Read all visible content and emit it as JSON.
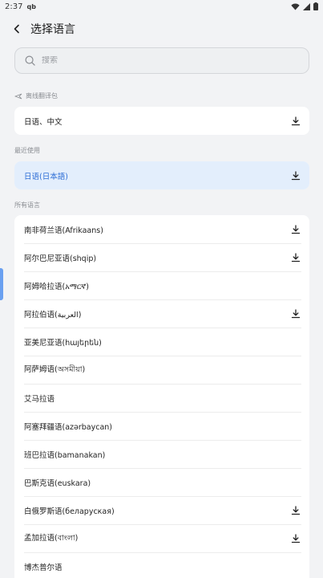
{
  "status": {
    "time": "2:37",
    "app_icon": "qb"
  },
  "header": {
    "title": "选择语言"
  },
  "search": {
    "placeholder": "搜索"
  },
  "offline": {
    "label": "离线翻译包",
    "items": [
      {
        "label": "日语、中文",
        "download": true
      }
    ]
  },
  "recent": {
    "label": "最近使用",
    "items": [
      {
        "label": "日语(日本語)",
        "download": true,
        "selected": true
      }
    ]
  },
  "all": {
    "label": "所有语言",
    "items": [
      {
        "label": "南非荷兰语(Afrikaans)",
        "download": true
      },
      {
        "label": "阿尔巴尼亚语(shqip)",
        "download": true
      },
      {
        "label": "阿姆哈拉语(አማርኛ)",
        "download": false
      },
      {
        "label": "阿拉伯语(العربية)",
        "download": true
      },
      {
        "label": "亚美尼亚语(հայերեն)",
        "download": false
      },
      {
        "label": "阿萨姆语(অসমীয়া)",
        "download": false
      },
      {
        "label": "艾马拉语",
        "download": false
      },
      {
        "label": "阿塞拜疆语(azərbaycan)",
        "download": false
      },
      {
        "label": "班巴拉语(bamanakan)",
        "download": false
      },
      {
        "label": "巴斯克语(euskara)",
        "download": false
      },
      {
        "label": "白俄罗斯语(беларуская)",
        "download": true
      },
      {
        "label": "孟加拉语(বাংলা)",
        "download": true
      },
      {
        "label": "博杰普尔语",
        "download": false
      }
    ]
  },
  "colors": {
    "accent": "#2f6fd6",
    "selected_bg": "#e3eefc",
    "page_bg": "#f2f3f5"
  },
  "icons": {
    "back": "chevron-left-icon",
    "search": "search-icon",
    "download": "download-icon",
    "offline": "airplane-icon",
    "wifi": "wifi-icon",
    "signal": "signal-icon",
    "battery": "battery-icon"
  }
}
